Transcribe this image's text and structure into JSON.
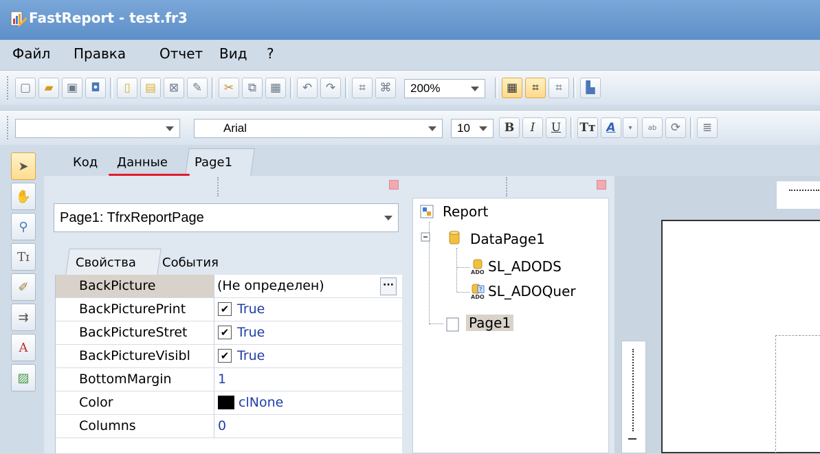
{
  "window": {
    "title": "FastReport - test.fr3"
  },
  "menu": [
    "Файл",
    "Правка",
    "Отчет",
    "Вид",
    "?"
  ],
  "toolbar": {
    "zoom": "200%"
  },
  "format_toolbar": {
    "style": "",
    "font": "Arial",
    "size": "10",
    "bold": "B",
    "italic": "I",
    "underline": "U"
  },
  "left_tools": {
    "text_tool": "A"
  },
  "tabs": [
    "Код",
    "Данные",
    "Page1"
  ],
  "inspector": {
    "object": "Page1: TfrxReportPage",
    "tabs": [
      "Свойства",
      "События"
    ],
    "rows": [
      {
        "name": "BackPicture",
        "value": "(Не определен)"
      },
      {
        "name": "BackPicturePrint",
        "value": "True"
      },
      {
        "name": "BackPictureStret",
        "value": "True"
      },
      {
        "name": "BackPictureVisibl",
        "value": "True"
      },
      {
        "name": "BottomMargin",
        "value": "1"
      },
      {
        "name": "Color",
        "value": "clNone"
      },
      {
        "name": "Columns",
        "value": "0"
      }
    ]
  },
  "tree": {
    "report": "Report",
    "datapage": "DataPage1",
    "ds1": "SL_ADODS",
    "ds2": "SL_ADOQuer",
    "page": "Page1"
  },
  "colors": {
    "accent_selected": "#ffdc8f",
    "value_text": "#1f3fa8",
    "underline": "#e21a2a"
  }
}
